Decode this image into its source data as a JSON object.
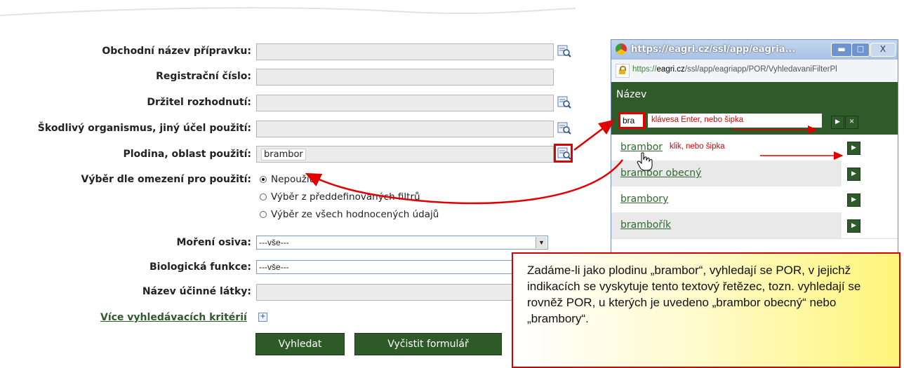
{
  "form": {
    "labels": {
      "trade_name": "Obchodní název přípravku:",
      "reg_number": "Registrační číslo:",
      "holder": "Držitel rozhodnutí:",
      "pest": "Škodlivý organismus, jiný účel použití:",
      "crop": "Plodina, oblast použití:",
      "restriction": "Výběr dle omezení pro použití:",
      "seed": "Moření osiva:",
      "bio": "Biologická funkce:",
      "substance": "Název účinné látky:"
    },
    "crop_value": "brambor",
    "radio_options": [
      "Nepoužito",
      "Výběr z předdefinovaných filtrů",
      "Výběr ze všech hodnocených údajů"
    ],
    "radio_selected_index": 0,
    "seed_value": "---vše---",
    "bio_value": "---vše---",
    "more_criteria": "Více vyhledávacích kritérií",
    "search_button": "Vyhledat",
    "clear_button": "Vyčistit formulář"
  },
  "popup": {
    "title": "https://eagri.cz/ssl/app/eagria...",
    "url_prefix": "https://",
    "url_domain": "eagri.cz",
    "url_rest": "/ssl/app/eagriapp/POR/VyhledavaniFilterPl",
    "column_header": "Název",
    "filter_value": "bra",
    "filter_hint": "klávesa Enter, nebo šipka",
    "results": [
      "brambor",
      "brambor obecný",
      "brambory",
      "brambořík"
    ],
    "click_hint": "klik, nebo šipka"
  },
  "note": {
    "text": "Zadáme-li jako plodinu „brambor“, vyhledají se POR, v jejichž indikacích se vyskytuje tento textový řetězec, tozn. vyhledají se rovněž POR, u kterých je uvedeno „brambor obecný“ nebo „brambory“."
  },
  "colors": {
    "accent_green": "#2f5a2a",
    "annotation_red": "#e00000",
    "note_yellow": "#fff57a"
  }
}
